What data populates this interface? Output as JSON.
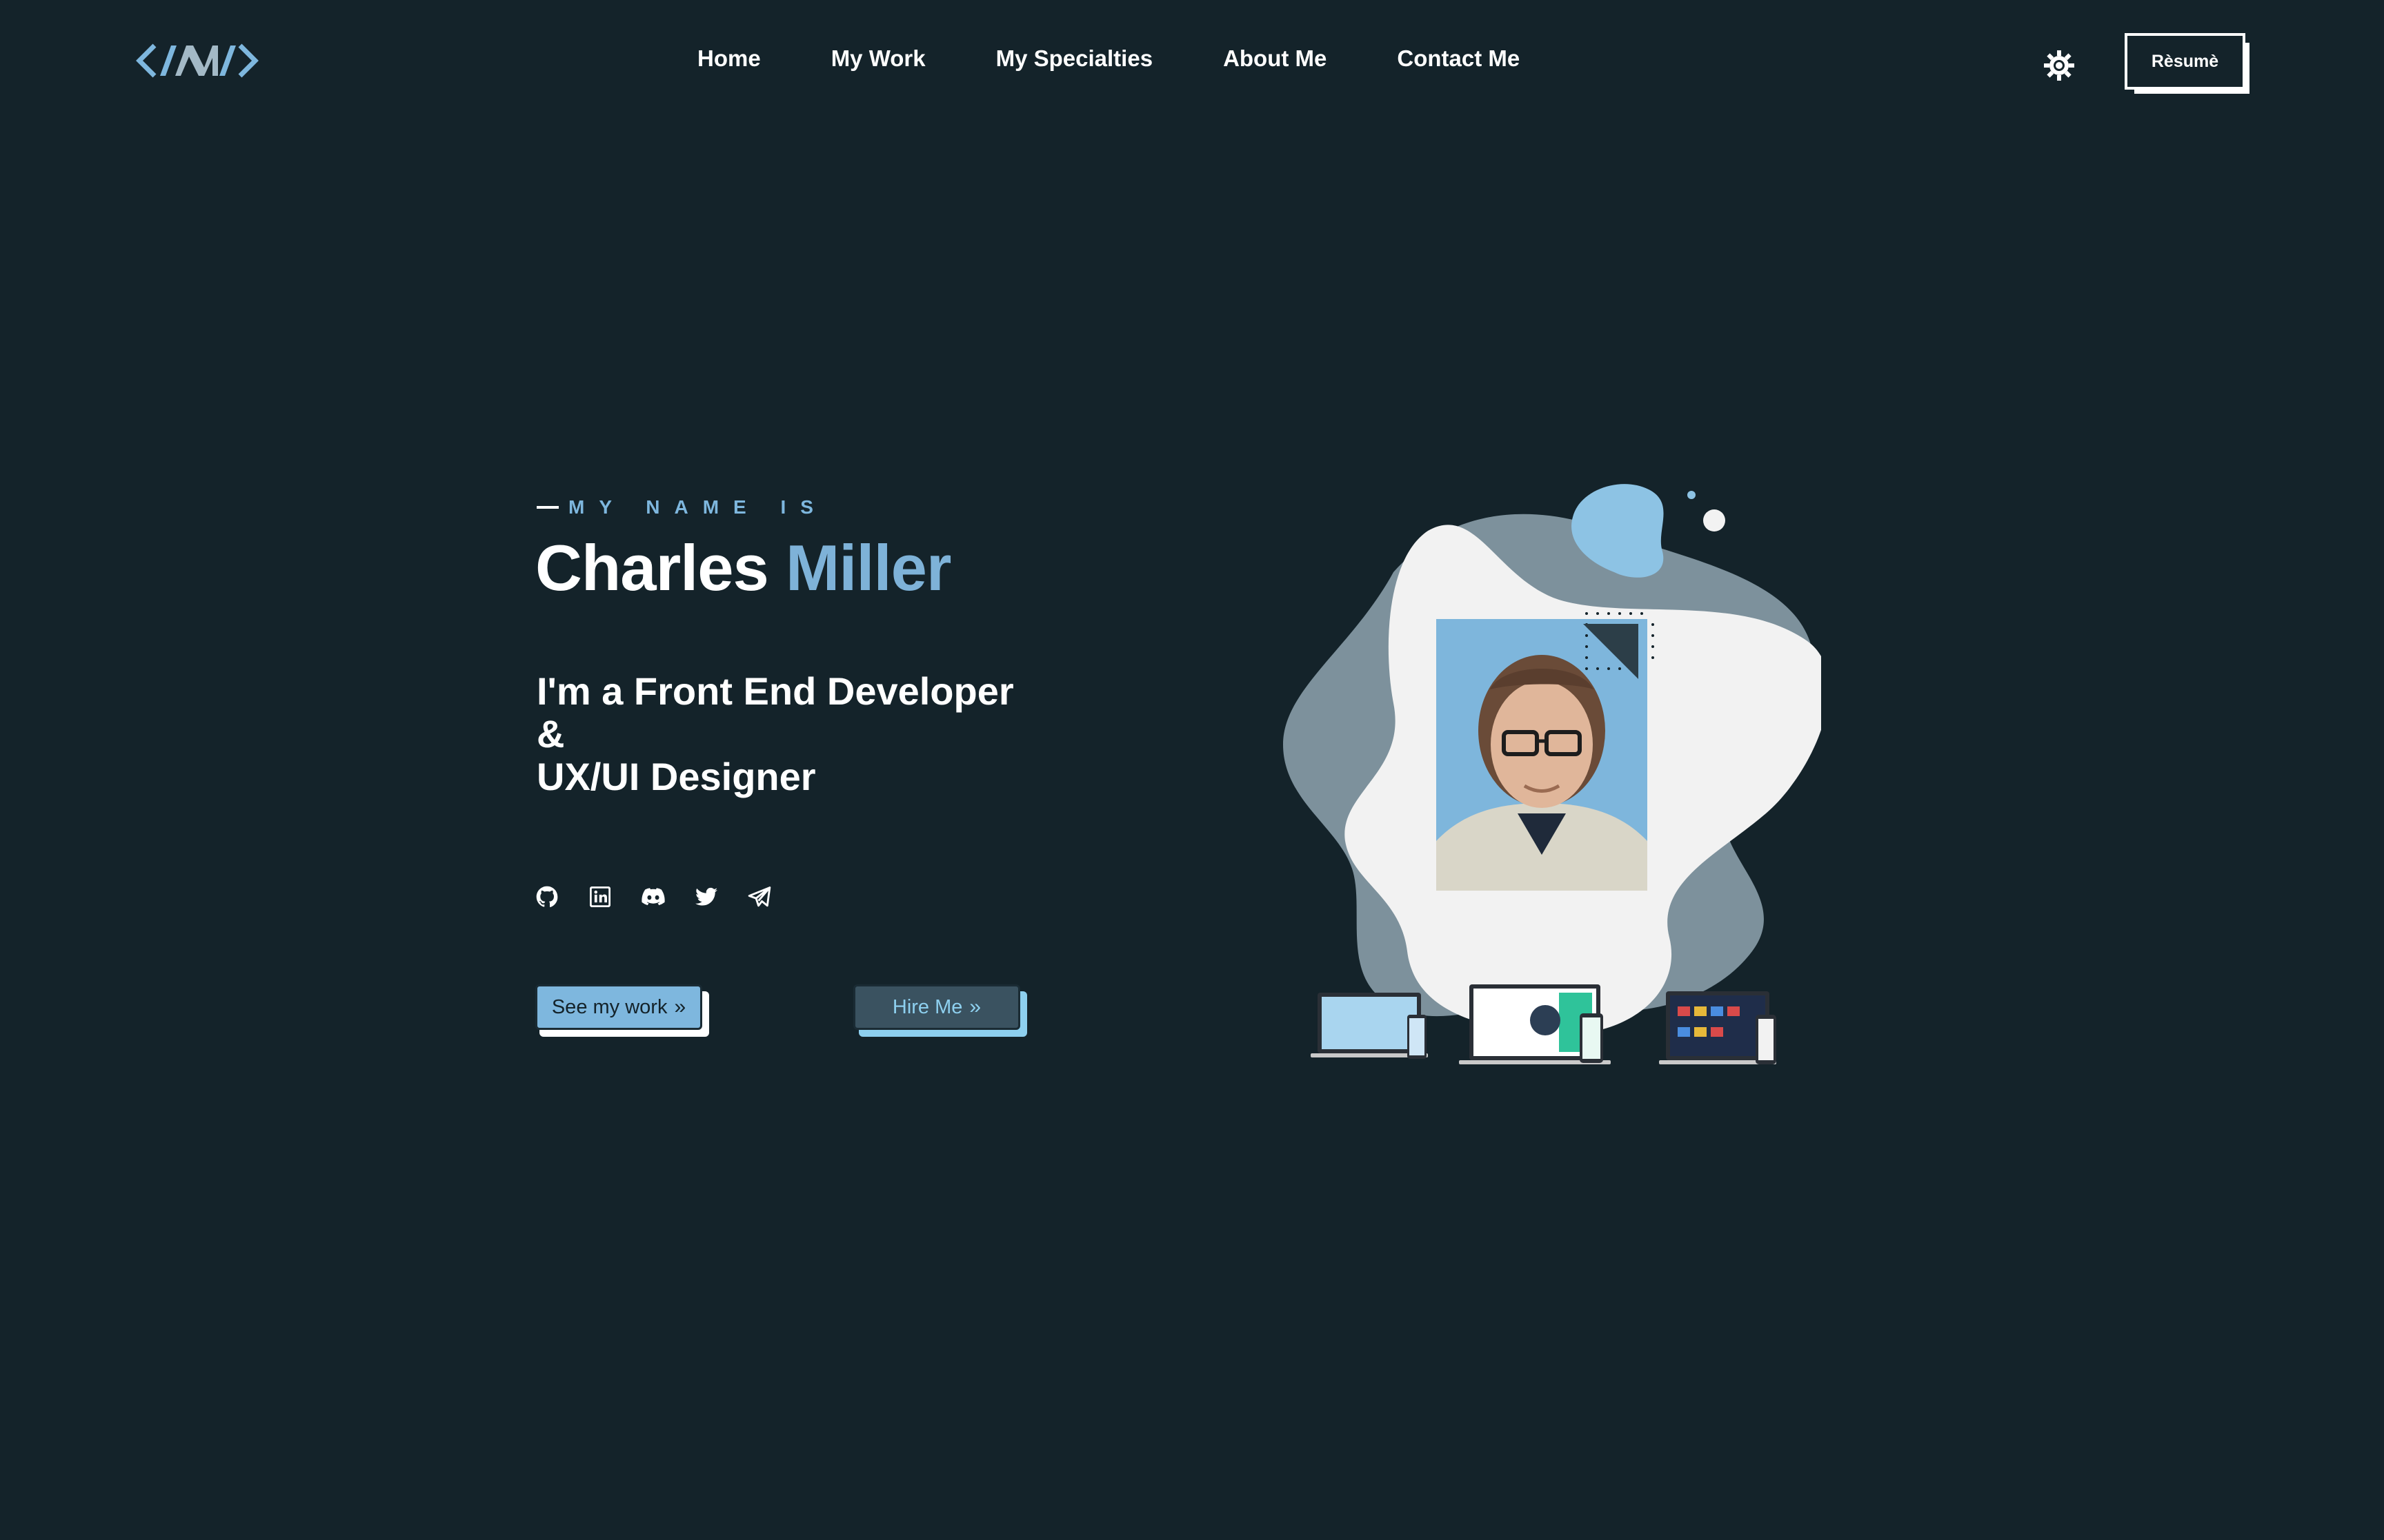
{
  "header": {
    "logo_icon": "code-brackets-logo",
    "nav": [
      {
        "label": "Home"
      },
      {
        "label": "My Work"
      },
      {
        "label": "My Specialties"
      },
      {
        "label": "About Me"
      },
      {
        "label": "Contact Me"
      }
    ],
    "theme_icon": "sun-gear-icon",
    "resume_label": "Rèsumè"
  },
  "hero": {
    "eyebrow": "MY NAME IS",
    "first_name": "Charles",
    "last_name": "Miller",
    "role_line1": "I'm a Front End Developer",
    "role_line2": "&",
    "role_line3": "UX/UI Designer",
    "socials": [
      {
        "icon": "github-icon"
      },
      {
        "icon": "linkedin-icon"
      },
      {
        "icon": "discord-icon"
      },
      {
        "icon": "twitter-icon"
      },
      {
        "icon": "telegram-icon"
      }
    ],
    "see_work_label": "See my work",
    "hire_label": "Hire Me"
  },
  "colors": {
    "background": "#14232a",
    "accent": "#7eb2d8",
    "light_accent": "#8ed0ef",
    "blob_gray": "#7d919c",
    "blob_white": "#f2f2f2"
  }
}
